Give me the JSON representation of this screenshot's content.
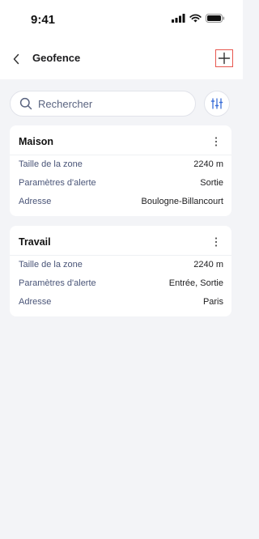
{
  "status_bar": {
    "time": "9:41"
  },
  "header": {
    "title": "Geofence"
  },
  "search": {
    "placeholder": "Rechercher"
  },
  "geofences": [
    {
      "name": "Maison",
      "rows": [
        {
          "label": "Taille de la zone",
          "value": "2240 m"
        },
        {
          "label": "Paramètres d'alerte",
          "value": "Sortie"
        },
        {
          "label": "Adresse",
          "value": "Boulogne-Billancourt"
        }
      ]
    },
    {
      "name": "Travail",
      "rows": [
        {
          "label": "Taille de la zone",
          "value": "2240 m"
        },
        {
          "label": "Paramètres d'alerte",
          "value": "Entrée, Sortie"
        },
        {
          "label": "Adresse",
          "value": "Paris"
        }
      ]
    }
  ],
  "colors": {
    "accent": "#3b6fd8",
    "add_highlight": "#e8574f",
    "background": "#f3f4f7",
    "label": "#4a5578"
  },
  "icons": {
    "back": "chevron-left-icon",
    "add": "plus-icon",
    "search": "search-icon",
    "filter": "sliders-icon",
    "more": "more-vertical-icon"
  }
}
